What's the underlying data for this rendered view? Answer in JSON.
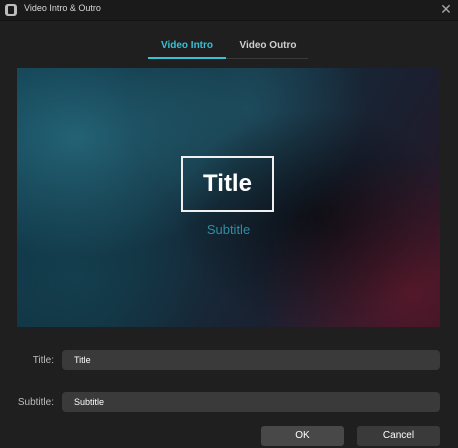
{
  "window": {
    "title": "Video Intro & Outro"
  },
  "tabs": [
    {
      "label": "Video Intro"
    },
    {
      "label": "Video Outro"
    }
  ],
  "preview": {
    "title_text": "Title",
    "subtitle_text": "Subtitle"
  },
  "form": {
    "title_label": "Title:",
    "title_value": "Title",
    "subtitle_label": "Subtitle:",
    "subtitle_value": "Subtitle"
  },
  "buttons": {
    "ok": "OK",
    "cancel": "Cancel"
  },
  "icons": {
    "app": "app-icon",
    "close": "close-icon"
  },
  "colors": {
    "accent": "#36c2d6",
    "background": "#1f1f1f",
    "field": "#3a3a3a"
  }
}
